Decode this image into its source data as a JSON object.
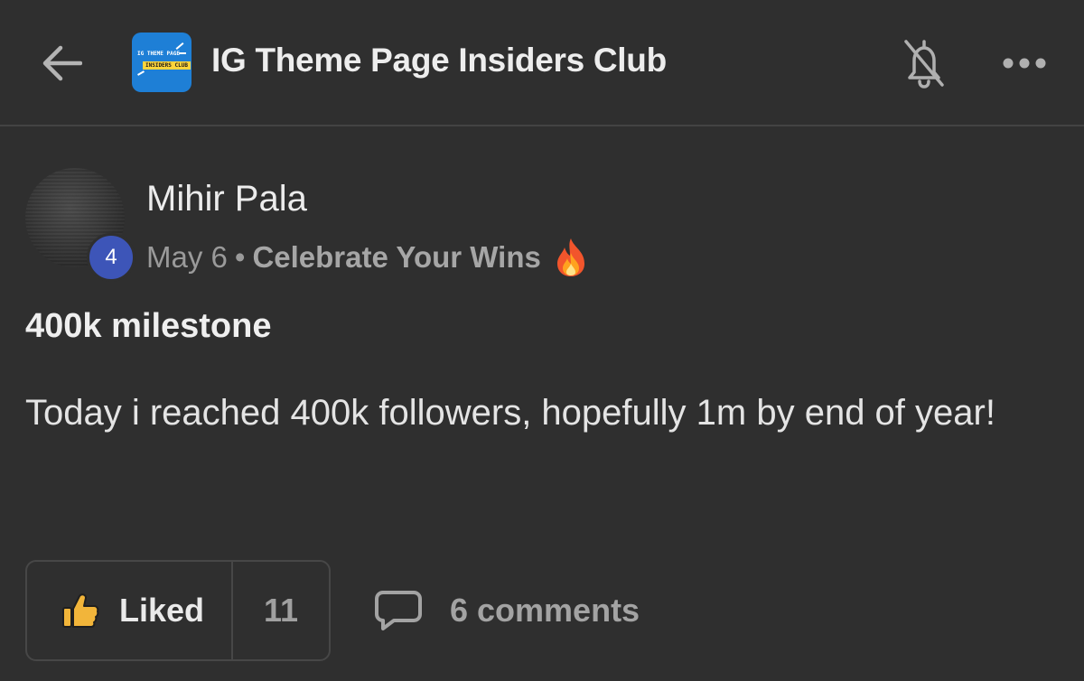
{
  "header": {
    "group_name": "IG Theme Page Insiders Club",
    "logo_line1": "IG THEME PAGE",
    "logo_line2": "INSIDERS CLUB"
  },
  "post": {
    "author": "Mihir Pala",
    "level": "4",
    "date": "May 6",
    "separator": "•",
    "category": "Celebrate Your Wins",
    "title": "400k milestone",
    "body": "Today i reached 400k followers, hopefully 1m by end of year!"
  },
  "actions": {
    "like_label": "Liked",
    "like_count": "11",
    "comments_label": "6 comments"
  },
  "colors": {
    "background": "#2f2f2f",
    "level_badge": "#3d55b8",
    "logo_bg": "#1e7fd6",
    "logo_banner": "#ffd43b",
    "thumb": "#f2b53a"
  },
  "icons": {
    "back": "arrow-left-icon",
    "bell": "bell-off-icon",
    "more": "more-horizontal-icon",
    "category_emoji": "fire-emoji-icon",
    "like": "thumbs-up-icon",
    "comment": "comment-bubble-icon"
  }
}
